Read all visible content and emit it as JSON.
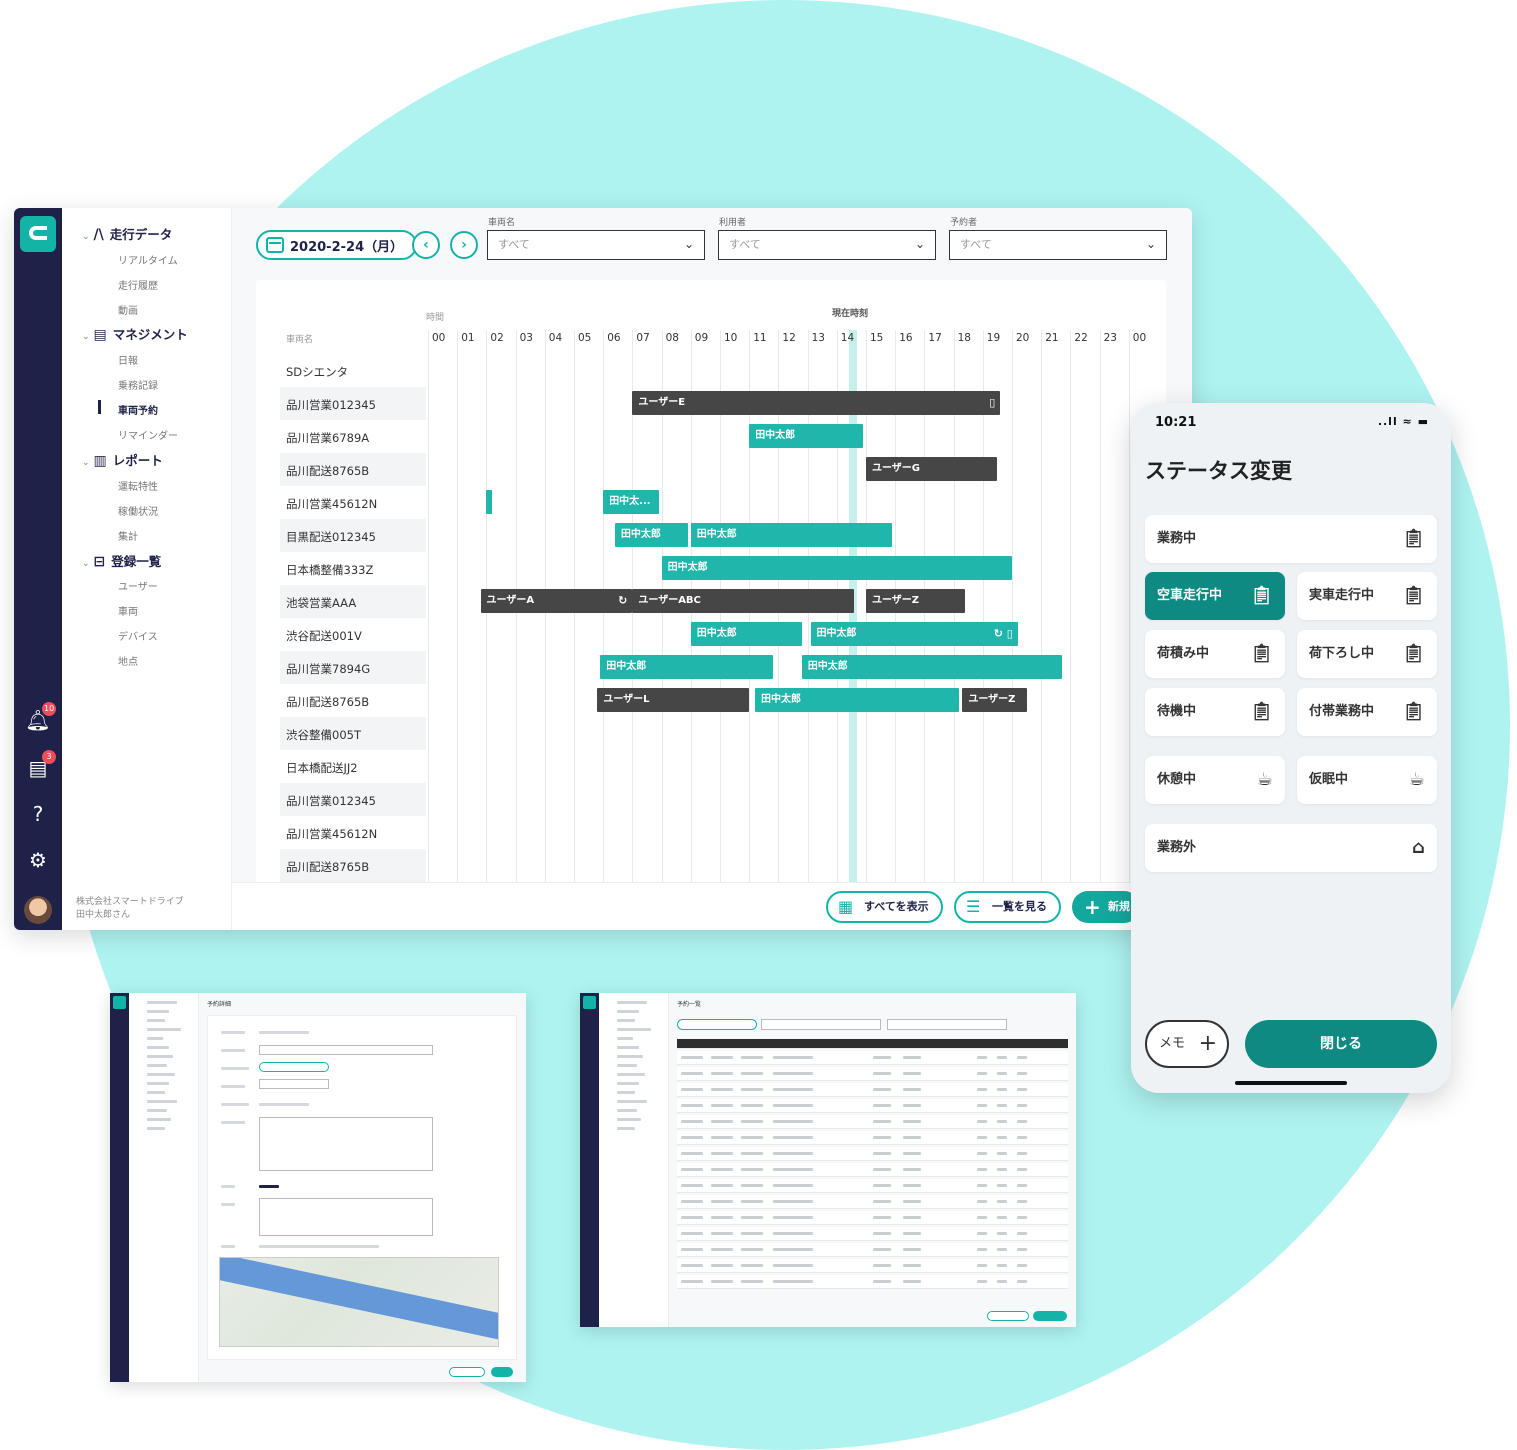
{
  "sidebar": {
    "groups": [
      {
        "label": "走行データ",
        "icon": "road-icon",
        "items": [
          "リアルタイム",
          "走行履歴",
          "動画"
        ]
      },
      {
        "label": "マネジメント",
        "icon": "clipboard-icon",
        "items": [
          "日報",
          "乗務記録",
          "車両予約",
          "リマインダー"
        ]
      },
      {
        "label": "レポート",
        "icon": "bar-chart-icon",
        "items": [
          "運転特性",
          "稼働状況",
          "集計"
        ]
      },
      {
        "label": "登録一覧",
        "icon": "briefcase-icon",
        "items": [
          "ユーザー",
          "車両",
          "デバイス",
          "地点"
        ]
      }
    ],
    "active_item": "車両予約",
    "company": "株式会社スマートドライブ",
    "user": "田中太郎さん"
  },
  "rail": {
    "notification_badge": "10",
    "document_badge": "3",
    "help_glyph": "?"
  },
  "toolbar": {
    "date": "2020-2-24（月）",
    "filters": [
      {
        "label": "車両名",
        "value": "すべて"
      },
      {
        "label": "利用者",
        "value": "すべて"
      },
      {
        "label": "予約者",
        "value": "すべて"
      }
    ]
  },
  "timeline": {
    "time_header": "時間",
    "vehicle_header": "車両名",
    "now_label": "現在時刻",
    "hours": [
      "00",
      "01",
      "02",
      "03",
      "04",
      "05",
      "06",
      "07",
      "08",
      "09",
      "10",
      "11",
      "12",
      "13",
      "14",
      "15",
      "16",
      "17",
      "18",
      "19",
      "20",
      "21",
      "22",
      "23",
      "00"
    ],
    "vehicles": [
      "SDシエンタ",
      "品川営業012345",
      "品川営業6789A",
      "品川配送8765B",
      "品川営業45612N",
      "目黒配送012345",
      "日本橋整備333Z",
      "池袋営業AAA",
      "渋谷配送001V",
      "品川営業7894G",
      "品川配送8765B",
      "渋谷整備005T",
      "日本橋配送JJ2",
      "品川営業012345",
      "品川営業45612N",
      "品川配送8765B"
    ],
    "bars": [
      {
        "row": 1,
        "label": "ユーザーE",
        "color": "dark",
        "start": 7.0,
        "end": 19.6,
        "end_icon": "document-icon"
      },
      {
        "row": 2,
        "label": "田中太郎",
        "color": "teal",
        "start": 11.0,
        "end": 14.9
      },
      {
        "row": 3,
        "label": "ユーザーG",
        "color": "dark",
        "start": 15.0,
        "end": 19.5
      },
      {
        "row": 4,
        "label": "",
        "color": "teal",
        "start": 2.0,
        "end": 2.2
      },
      {
        "row": 4,
        "label": "田中太...",
        "color": "teal",
        "start": 6.0,
        "end": 7.9
      },
      {
        "row": 5,
        "label": "田中太郎",
        "color": "teal",
        "start": 6.4,
        "end": 8.9
      },
      {
        "row": 5,
        "label": "田中太郎",
        "color": "teal",
        "start": 9.0,
        "end": 15.9
      },
      {
        "row": 6,
        "label": "田中太郎",
        "color": "teal",
        "start": 8.0,
        "end": 20.0
      },
      {
        "row": 7,
        "label": "ユーザーA",
        "color": "dark",
        "start": 1.8,
        "end": 7.0,
        "end_icon": "sync-icon"
      },
      {
        "row": 7,
        "label": "ユーザーABC",
        "color": "dark",
        "start": 7.0,
        "end": 14.6
      },
      {
        "row": 7,
        "label": "ユーザーZ",
        "color": "dark",
        "start": 15.0,
        "end": 18.4
      },
      {
        "row": 8,
        "label": "田中太郎",
        "color": "teal",
        "start": 9.0,
        "end": 12.8
      },
      {
        "row": 8,
        "label": "田中太郎",
        "color": "teal",
        "start": 13.1,
        "end": 20.2,
        "end_icon": "sync-doc-icon"
      },
      {
        "row": 9,
        "label": "田中太郎",
        "color": "teal",
        "start": 5.9,
        "end": 11.8
      },
      {
        "row": 9,
        "label": "田中太郎",
        "color": "teal",
        "start": 12.8,
        "end": 21.7
      },
      {
        "row": 10,
        "label": "ユーザーL",
        "color": "dark",
        "start": 5.8,
        "end": 11.0
      },
      {
        "row": 10,
        "label": "田中太郎",
        "color": "teal",
        "start": 11.2,
        "end": 18.2
      },
      {
        "row": 10,
        "label": "ユーザーZ",
        "color": "dark",
        "start": 18.3,
        "end": 20.5
      }
    ]
  },
  "actions": {
    "show_all": "すべてを表示",
    "view_list": "一覧を見る",
    "new_label": "新規"
  },
  "phone": {
    "time": "10:21",
    "status_icons": "..ll ≈ ▬",
    "title": "ステータス変更",
    "statuses": [
      {
        "label": "業務中",
        "icon": "clipboard-icon"
      },
      {
        "label": "空車走行中",
        "icon": "clipboard-icon",
        "active": true
      },
      {
        "label": "実車走行中",
        "icon": "clipboard-icon"
      },
      {
        "label": "荷積み中",
        "icon": "clipboard-icon"
      },
      {
        "label": "荷下ろし中",
        "icon": "clipboard-icon"
      },
      {
        "label": "待機中",
        "icon": "clipboard-icon"
      },
      {
        "label": "付帯業務中",
        "icon": "clipboard-icon"
      },
      {
        "label": "休憩中",
        "icon": "coffee-icon"
      },
      {
        "label": "仮眠中",
        "icon": "coffee-icon"
      },
      {
        "label": "業務外",
        "icon": "home-icon"
      }
    ],
    "memo_label": "メモ",
    "close_label": "閉じる"
  },
  "mini_screens": {
    "detail_title": "予約詳細",
    "list_title": "予約一覧"
  }
}
